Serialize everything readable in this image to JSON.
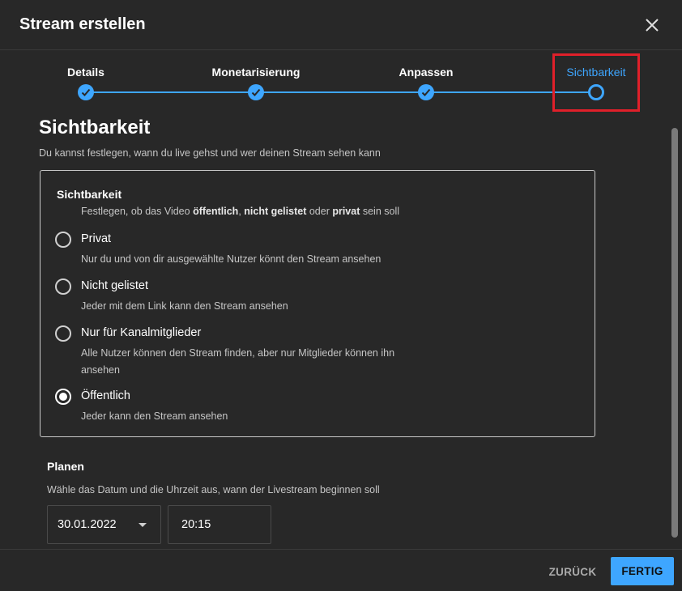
{
  "dialog": {
    "title": "Stream erstellen",
    "close_icon": "close-icon"
  },
  "stepper": {
    "steps": [
      {
        "label": "Details",
        "state": "completed"
      },
      {
        "label": "Monetarisierung",
        "state": "completed"
      },
      {
        "label": "Anpassen",
        "state": "completed"
      },
      {
        "label": "Sichtbarkeit",
        "state": "current"
      }
    ]
  },
  "section": {
    "title": "Sichtbarkeit",
    "subtitle": "Du kannst festlegen, wann du live gehst und wer deinen Stream sehen kann"
  },
  "visibility": {
    "heading": "Sichtbarkeit",
    "desc_prefix": "Festlegen, ob das Video ",
    "desc_public": "öffentlich",
    "desc_comma": ", ",
    "desc_unlisted": "nicht gelistet",
    "desc_or": " oder ",
    "desc_private": "privat",
    "desc_suffix": " sein soll",
    "options": [
      {
        "label": "Privat",
        "desc": "Nur du und von dir ausgewählte Nutzer könnt den Stream ansehen",
        "checked": false
      },
      {
        "label": "Nicht gelistet",
        "desc": "Jeder mit dem Link kann den Stream ansehen",
        "checked": false
      },
      {
        "label": "Nur für Kanalmitglieder",
        "desc": "Alle Nutzer können den Stream finden, aber nur Mitglieder können ihn ansehen",
        "checked": false
      },
      {
        "label": "Öffentlich",
        "desc": "Jeder kann den Stream ansehen",
        "checked": true
      }
    ]
  },
  "schedule": {
    "title": "Planen",
    "subtitle": "Wähle das Datum und die Uhrzeit aus, wann der Livestream beginnen soll",
    "date": "30.01.2022",
    "time": "20:15"
  },
  "footer": {
    "back_label": "ZURÜCK",
    "done_label": "FERTIG"
  },
  "colors": {
    "accent": "#3ea6ff",
    "background": "#282828",
    "highlight": "#e0202a"
  }
}
